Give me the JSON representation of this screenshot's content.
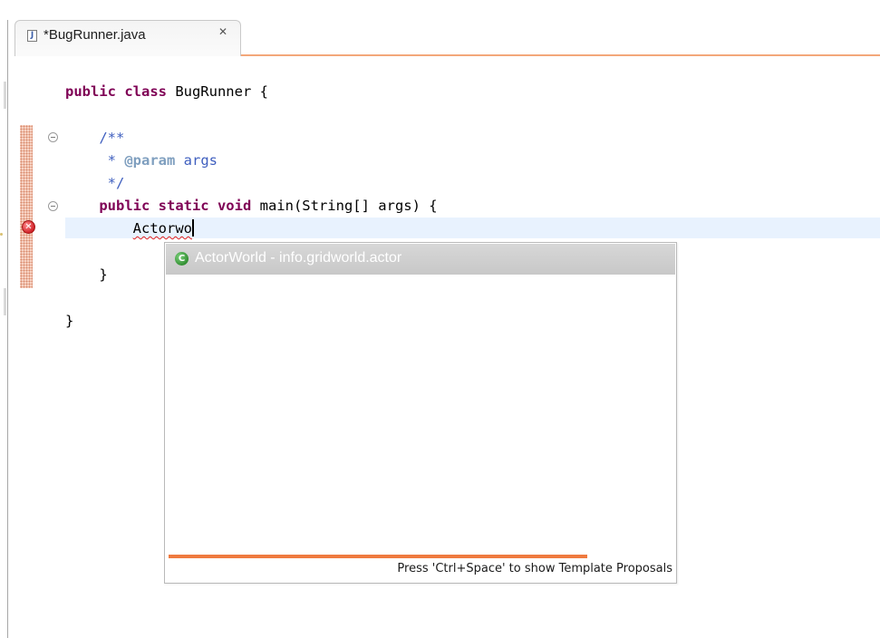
{
  "editor_tab": {
    "icon": "java-file-icon",
    "icon_glyph": "J",
    "title": "*BugRunner.java",
    "close_glyph": "✕"
  },
  "code": {
    "line1_kw": "public class",
    "line1_rest": " BugRunner {",
    "line3": "/**",
    "line4_star": " * ",
    "line4_tag": "@param",
    "line4_rest": " args",
    "line5": " */",
    "line6_kw": "public static void",
    "line6_rest": " main(String[] args) {",
    "line7_typed": "Actorwo",
    "line9": "}",
    "line11": "}"
  },
  "gutter": {
    "error_glyph": "✕"
  },
  "completion": {
    "icon": "class-icon",
    "icon_glyph": "C",
    "proposal": "ActorWorld - info.gridworld.actor",
    "status": "Press 'Ctrl+Space' to show Template Proposals"
  },
  "colors": {
    "keyword": "#7f0055",
    "javadoc": "#3f5fbf",
    "current_line": "#e8f2fe",
    "tab_accent": "#f3a779",
    "progress": "#ef7a3f"
  }
}
